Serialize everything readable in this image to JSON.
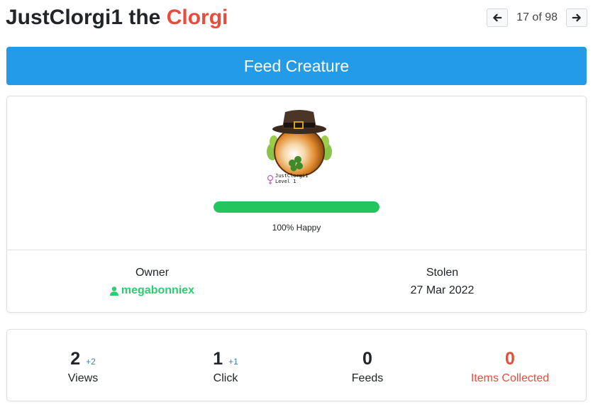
{
  "header": {
    "creature_name": "JustClorgi1",
    "connector": " the ",
    "species": "Clorgi",
    "pager": {
      "text": "17 of 98",
      "prev_icon": "arrow-left-icon",
      "next_icon": "arrow-right-icon"
    }
  },
  "feed_button": {
    "label": "Feed Creature",
    "color": "#239be6"
  },
  "creature": {
    "image_name_text": "JustClorgi1",
    "image_level_text": "Level 1",
    "happiness": {
      "percent": 100,
      "label": "100% Happy",
      "color": "#22c55e"
    }
  },
  "info": {
    "owner_label": "Owner",
    "owner_name": "megabonniex",
    "owner_icon": "user-icon",
    "stolen_label": "Stolen",
    "stolen_date": "27 Mar 2022"
  },
  "stats": [
    {
      "value": "2",
      "increment": "+2",
      "label": "Views"
    },
    {
      "value": "1",
      "increment": "+1",
      "label": "Click"
    },
    {
      "value": "0",
      "increment": "",
      "label": "Feeds"
    },
    {
      "value": "0",
      "increment": "",
      "label": "Items Collected",
      "color": "#e74c3c"
    }
  ]
}
